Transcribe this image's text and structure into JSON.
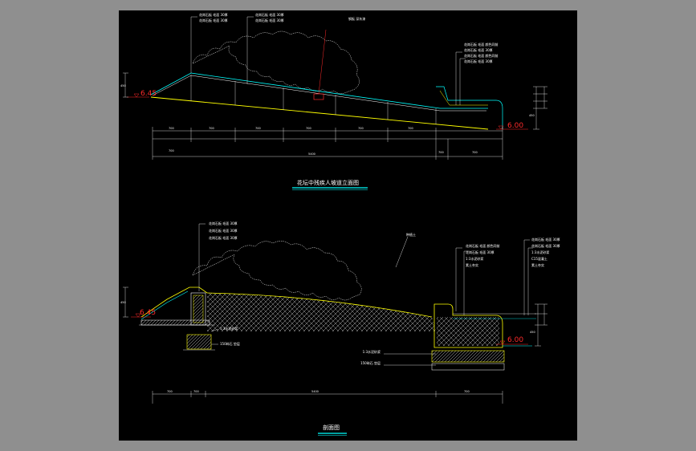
{
  "colors": {
    "background": "#8f8f8f",
    "sheet": "#000000",
    "line_white": "#ffffff",
    "line_yellow": "#ffff00",
    "line_cyan": "#00ffff",
    "line_green": "#00ff00",
    "line_red": "#ff2a2a",
    "line_magenta": "#ff00ff"
  },
  "elevation_view": {
    "title": "花坛中残疾人坡道立面图",
    "elevation_left": "6.45",
    "elevation_right": "6.00",
    "callouts_top": [
      "花岗石板 毛面 30厚",
      "花岗石板 毛面 30厚"
    ],
    "callout_center": "钢板 深灰漆",
    "callouts_right": [
      "花岗石板 毛面 颜色同前",
      "花岗石板 毛面 30厚"
    ],
    "dim_total": "5400",
    "dim_sub": "700",
    "dim_height": "450"
  },
  "section_view": {
    "title": "剖面图",
    "elevation_left": "6.45",
    "elevation_right": "6.00",
    "callouts_left": [
      "花岗石板 毛面 30厚",
      "花岗石板 毛面 30厚"
    ],
    "callout_planting": "种植土",
    "callouts_right_a": [
      "花岗石板 毛面 颜色同前",
      "花岗石板 毛面 30厚",
      "1:3水泥砂浆",
      "素土夯实"
    ],
    "callouts_right_b": [
      "花岗石板 毛面 30厚",
      "花岗石板 毛面 30厚",
      "1:3水泥砂浆",
      "C15混凝土",
      "素土夯实"
    ],
    "callouts_base_left": [
      "1:3水泥砂浆",
      "150碎石 垫层"
    ],
    "callouts_base_right": [
      "1:3水泥砂浆",
      "150碎石 垫层"
    ],
    "dim_total": "5400",
    "dim_sub": "700",
    "dim_height": "450"
  }
}
